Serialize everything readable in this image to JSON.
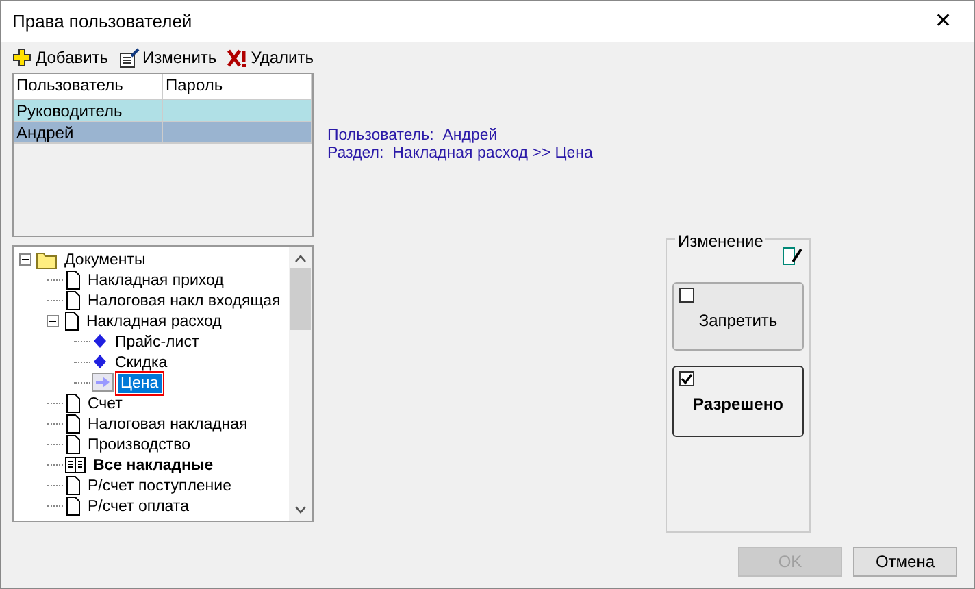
{
  "window": {
    "title": "Права пользователей",
    "close": "✕"
  },
  "toolbar": [
    {
      "kind": "add",
      "label": "Добавить"
    },
    {
      "kind": "edit",
      "label": "Изменить"
    },
    {
      "kind": "delete",
      "label": "Удалить"
    }
  ],
  "users": {
    "columns": [
      "Пользователь",
      "Пароль"
    ],
    "rows": [
      {
        "name": "Руководитель",
        "selected": false
      },
      {
        "name": "Андрей",
        "selected": true
      }
    ]
  },
  "tree": [
    {
      "kind": "folder",
      "label": "Документы",
      "expanded": true,
      "selected": false,
      "bold": false,
      "children": [
        {
          "kind": "doc",
          "label": "Накладная приход",
          "selected": false,
          "bold": false
        },
        {
          "kind": "doc",
          "label": "Налоговая накл входящая",
          "selected": false,
          "bold": false
        },
        {
          "kind": "doc",
          "label": "Накладная расход",
          "expanded": true,
          "selected": false,
          "bold": false,
          "children": [
            {
              "kind": "diamond",
              "label": "Прайс-лист",
              "selected": false,
              "bold": false
            },
            {
              "kind": "diamond",
              "label": "Скидка",
              "selected": false,
              "bold": false
            },
            {
              "kind": "arrow",
              "label": "Цена",
              "selected": true,
              "bold": false
            }
          ]
        },
        {
          "kind": "doc",
          "label": "Счет",
          "selected": false,
          "bold": false
        },
        {
          "kind": "doc",
          "label": "Налоговая накладная",
          "selected": false,
          "bold": false
        },
        {
          "kind": "doc",
          "label": "Производство",
          "selected": false,
          "bold": false
        },
        {
          "kind": "list",
          "label": "Все накладные",
          "selected": false,
          "bold": true
        },
        {
          "kind": "doc",
          "label": "Р/счет поступление",
          "selected": false,
          "bold": false
        },
        {
          "kind": "doc",
          "label": "Р/счет оплата",
          "selected": false,
          "bold": false
        }
      ]
    }
  ],
  "info": [
    {
      "label": "Пользователь:",
      "value": "Андрей"
    },
    {
      "label": "Раздел:",
      "value": "Накладная расход >> Цена"
    }
  ],
  "group": {
    "title": "Изменение",
    "options": [
      {
        "label": "Запретить",
        "checked": false
      },
      {
        "label": "Разрешено",
        "checked": true
      }
    ]
  },
  "buttons": [
    {
      "label": "OK",
      "disabled": true
    },
    {
      "label": "Отмена",
      "disabled": false
    }
  ]
}
